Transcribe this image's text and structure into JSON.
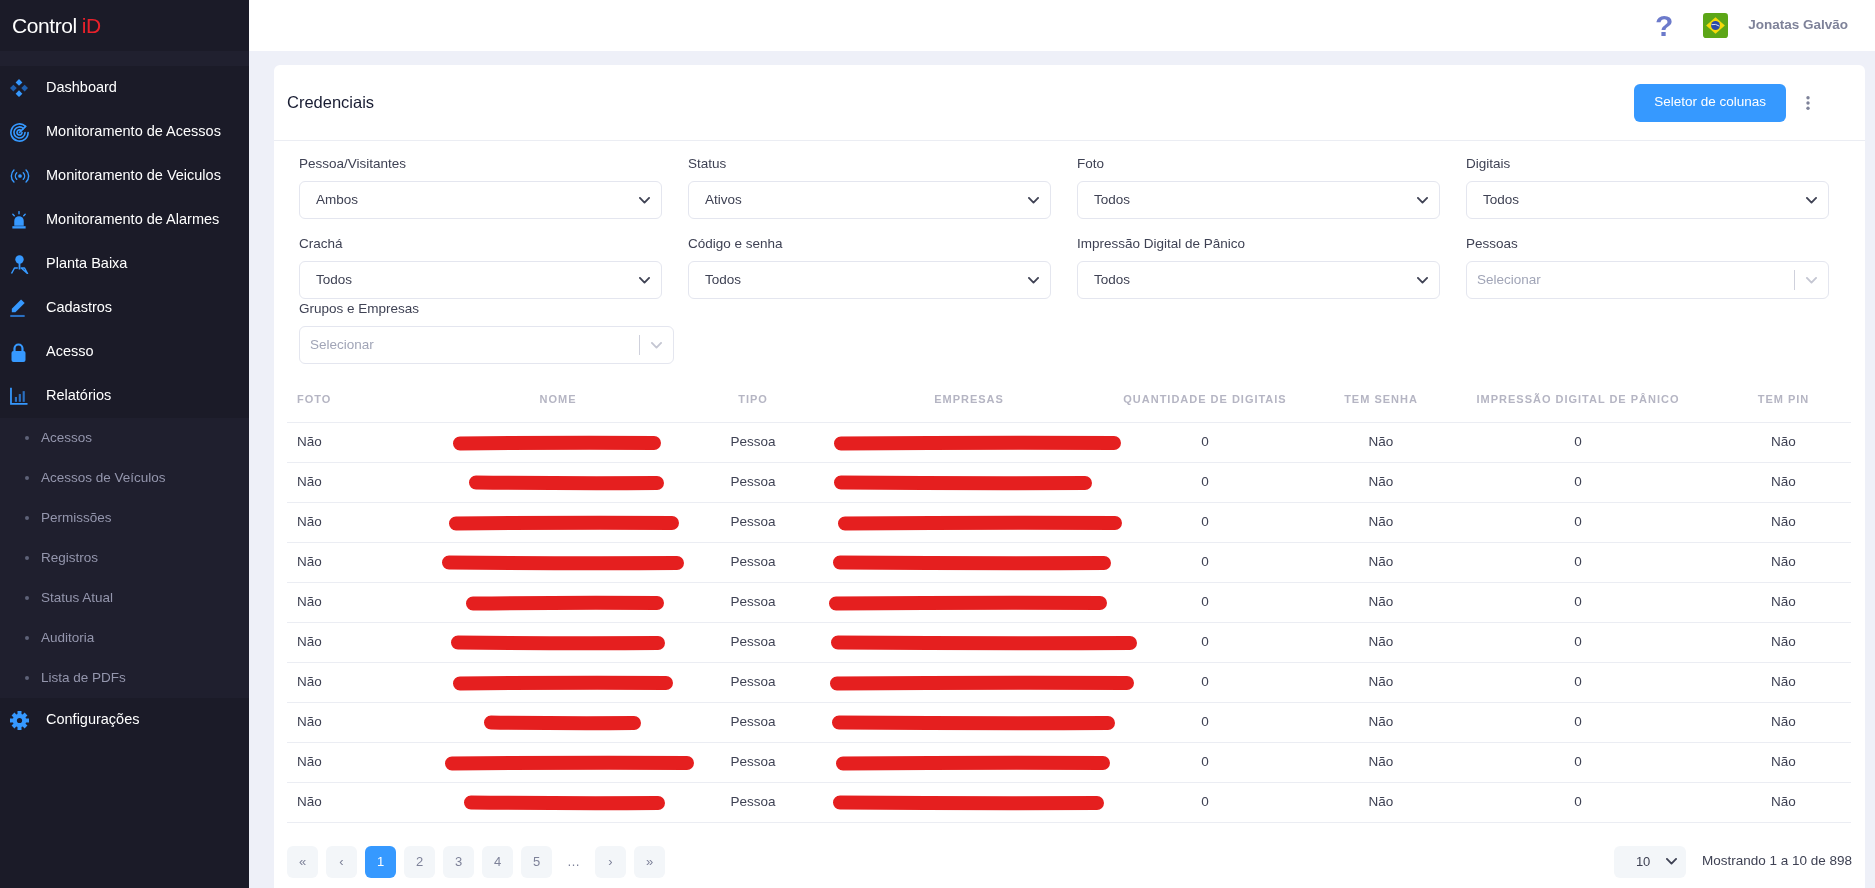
{
  "sidebar": {
    "logo": {
      "text": "Control",
      "accent": "iD"
    },
    "items": [
      {
        "label": "Dashboard"
      },
      {
        "label": "Monitoramento de Acessos"
      },
      {
        "label": "Monitoramento de Veiculos"
      },
      {
        "label": "Monitoramento de Alarmes"
      },
      {
        "label": "Planta Baixa"
      },
      {
        "label": "Cadastros"
      },
      {
        "label": "Acesso"
      },
      {
        "label": "Relatórios",
        "expanded": true,
        "children": [
          {
            "label": "Acessos"
          },
          {
            "label": "Acessos de Veículos"
          },
          {
            "label": "Permissões"
          },
          {
            "label": "Registros"
          },
          {
            "label": "Status Atual"
          },
          {
            "label": "Auditoria"
          },
          {
            "label": "Lista de PDFs"
          }
        ]
      },
      {
        "label": "Configurações"
      }
    ]
  },
  "topbar": {
    "help": "?",
    "user_name": "Jonatas Galvão"
  },
  "card": {
    "title": "Credenciais",
    "column_selector_button": "Seletor de colunas"
  },
  "filters": [
    {
      "label": "Pessoa/Visitantes",
      "kind": "select",
      "value": "Ambos"
    },
    {
      "label": "Status",
      "kind": "select",
      "value": "Ativos"
    },
    {
      "label": "Foto",
      "kind": "select",
      "value": "Todos"
    },
    {
      "label": "Digitais",
      "kind": "select",
      "value": "Todos"
    },
    {
      "label": "Crachá",
      "kind": "select",
      "value": "Todos"
    },
    {
      "label": "Código e senha",
      "kind": "select",
      "value": "Todos"
    },
    {
      "label": "Impressão Digital de Pânico",
      "kind": "select",
      "value": "Todos"
    },
    {
      "label": "Pessoas",
      "kind": "multiselect",
      "placeholder": "Selecionar"
    },
    {
      "label": "Grupos e Empresas",
      "kind": "multiselect",
      "placeholder": "Selecionar"
    }
  ],
  "table": {
    "columns": [
      "FOTO",
      "NOME",
      "TIPO",
      "EMPRESAS",
      "QUANTIDADE DE DIGITAIS",
      "TEM SENHA",
      "IMPRESSÃO DIGITAL DE PÂNICO",
      "TEM PIN"
    ],
    "rows": [
      {
        "foto": "Não",
        "nome_redacted": true,
        "tipo": "Pessoa",
        "empresas_redacted": true,
        "quantidade_de_digitais": "0",
        "tem_senha": "Não",
        "impressao_digital_de_panico": "0",
        "tem_pin": "Não"
      },
      {
        "foto": "Não",
        "nome_redacted": true,
        "tipo": "Pessoa",
        "empresas_redacted": true,
        "quantidade_de_digitais": "0",
        "tem_senha": "Não",
        "impressao_digital_de_panico": "0",
        "tem_pin": "Não"
      },
      {
        "foto": "Não",
        "nome_redacted": true,
        "tipo": "Pessoa",
        "empresas_redacted": true,
        "quantidade_de_digitais": "0",
        "tem_senha": "Não",
        "impressao_digital_de_panico": "0",
        "tem_pin": "Não"
      },
      {
        "foto": "Não",
        "nome_redacted": true,
        "tipo": "Pessoa",
        "empresas_redacted": true,
        "quantidade_de_digitais": "0",
        "tem_senha": "Não",
        "impressao_digital_de_panico": "0",
        "tem_pin": "Não"
      },
      {
        "foto": "Não",
        "nome_redacted": true,
        "tipo": "Pessoa",
        "empresas_redacted": true,
        "quantidade_de_digitais": "0",
        "tem_senha": "Não",
        "impressao_digital_de_panico": "0",
        "tem_pin": "Não"
      },
      {
        "foto": "Não",
        "nome_redacted": true,
        "tipo": "Pessoa",
        "empresas_redacted": true,
        "quantidade_de_digitais": "0",
        "tem_senha": "Não",
        "impressao_digital_de_panico": "0",
        "tem_pin": "Não"
      },
      {
        "foto": "Não",
        "nome_redacted": true,
        "tipo": "Pessoa",
        "empresas_redacted": true,
        "quantidade_de_digitais": "0",
        "tem_senha": "Não",
        "impressao_digital_de_panico": "0",
        "tem_pin": "Não"
      },
      {
        "foto": "Não",
        "nome_redacted": true,
        "tipo": "Pessoa",
        "empresas_redacted": true,
        "quantidade_de_digitais": "0",
        "tem_senha": "Não",
        "impressao_digital_de_panico": "0",
        "tem_pin": "Não"
      },
      {
        "foto": "Não",
        "nome_redacted": true,
        "tipo": "Pessoa",
        "empresas_redacted": true,
        "quantidade_de_digitais": "0",
        "tem_senha": "Não",
        "impressao_digital_de_panico": "0",
        "tem_pin": "Não"
      },
      {
        "foto": "Não",
        "nome_redacted": true,
        "tipo": "Pessoa",
        "empresas_redacted": true,
        "quantidade_de_digitais": "0",
        "tem_senha": "Não",
        "impressao_digital_de_panico": "0",
        "tem_pin": "Não"
      }
    ]
  },
  "pagination": {
    "first": "«",
    "previous": "‹",
    "pages": [
      {
        "label": "1",
        "selected": true
      },
      {
        "label": "2",
        "selected": false
      },
      {
        "label": "3",
        "selected": false
      },
      {
        "label": "4",
        "selected": false
      },
      {
        "label": "5",
        "selected": false
      }
    ],
    "ellipsis": "…",
    "next": "›",
    "last": "»",
    "page_size": "10",
    "summary": "Mostrando 1 a 10 de 898"
  }
}
